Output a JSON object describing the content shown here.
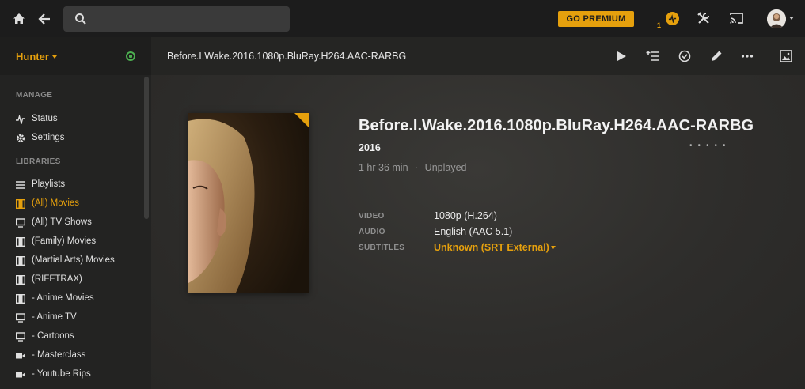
{
  "topbar": {
    "search": {
      "placeholder": "",
      "value": ""
    },
    "premium_label": "GO PREMIUM",
    "activity_count": "1"
  },
  "sidebar": {
    "server_name": "Hunter",
    "sections": {
      "manage": "MANAGE",
      "libraries": "LIBRARIES"
    },
    "manage_items": [
      {
        "label": "Status",
        "icon": "pulse-icon"
      },
      {
        "label": "Settings",
        "icon": "gear-icon"
      }
    ],
    "library_items": [
      {
        "label": "Playlists",
        "icon": "list-icon"
      },
      {
        "label": "(All) Movies",
        "icon": "film-icon",
        "active": true
      },
      {
        "label": "(All) TV Shows",
        "icon": "tv-icon"
      },
      {
        "label": "(Family) Movies",
        "icon": "film-icon"
      },
      {
        "label": "(Martial Arts) Movies",
        "icon": "film-icon"
      },
      {
        "label": "(RIFFTRAX)",
        "icon": "film-icon"
      },
      {
        "label": "- Anime Movies",
        "icon": "film-icon"
      },
      {
        "label": "- Anime TV",
        "icon": "tv-icon"
      },
      {
        "label": "- Cartoons",
        "icon": "tv-icon"
      },
      {
        "label": "- Masterclass",
        "icon": "camera-icon"
      },
      {
        "label": "- Youtube Rips",
        "icon": "camera-icon"
      }
    ]
  },
  "content": {
    "header_title": "Before.I.Wake.2016.1080p.BluRay.H264.AAC-RARBG",
    "title": "Before.I.Wake.2016.1080p.BluRay.H264.AAC-RARBG",
    "year": "2016",
    "duration": "1 hr 36 min",
    "meta_sep": "·",
    "play_state": "Unplayed",
    "rating_dots": "•••••",
    "info": {
      "video_label": "VIDEO",
      "video_value": "1080p (H.264)",
      "audio_label": "AUDIO",
      "audio_value": "English (AAC 5.1)",
      "subtitles_label": "SUBTITLES",
      "subtitles_value": "Unknown (SRT External)"
    }
  },
  "colors": {
    "accent": "#e5a00d",
    "topbar_bg": "#1c1c1c",
    "sidebar_bg": "#232322",
    "online": "#4caf50"
  }
}
